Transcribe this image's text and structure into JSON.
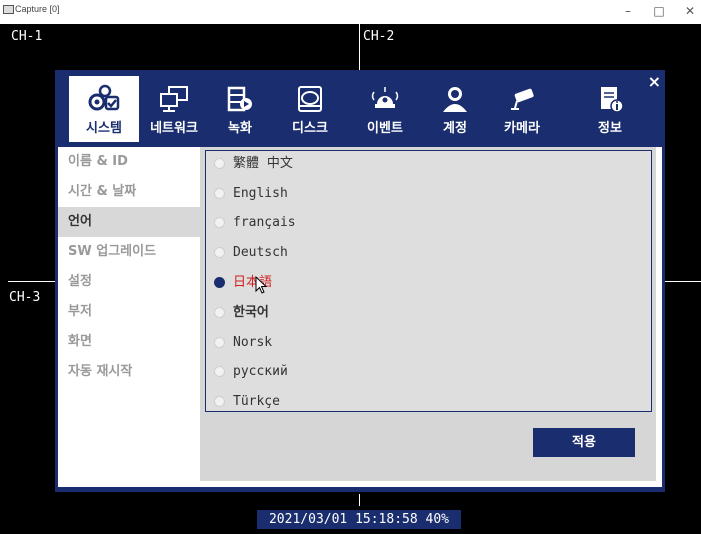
{
  "window": {
    "title": "Capture [0]",
    "minimize": "–",
    "maximize": "□",
    "close": "✕"
  },
  "channels": {
    "ch1": "CH-1",
    "ch2": "CH-2",
    "ch3": "CH-3"
  },
  "status_bar": {
    "datetime": "2021/03/01 15:18:58",
    "percent": "40%"
  },
  "dialog": {
    "close": "×",
    "tabs": [
      {
        "label": "시스템",
        "icon": "gears-icon",
        "active": true
      },
      {
        "label": "네트워크",
        "icon": "network-icon"
      },
      {
        "label": "녹화",
        "icon": "record-icon"
      },
      {
        "label": "디스크",
        "icon": "disk-icon"
      },
      {
        "label": "이벤트",
        "icon": "alarm-icon"
      },
      {
        "label": "계정",
        "icon": "user-icon"
      },
      {
        "label": "카메라",
        "icon": "camera-icon"
      },
      {
        "label": "정보",
        "icon": "info-icon"
      }
    ],
    "menu": [
      {
        "label": "이름 & ID"
      },
      {
        "label": "시간 & 날짜"
      },
      {
        "label": "언어",
        "active": true
      },
      {
        "label": "SW 업그레이드"
      },
      {
        "label": "설정"
      },
      {
        "label": "부저"
      },
      {
        "label": "화면"
      },
      {
        "label": "자동 재시작"
      }
    ],
    "languages": [
      {
        "label": "繁體 中文"
      },
      {
        "label": "English"
      },
      {
        "label": "français"
      },
      {
        "label": "Deutsch"
      },
      {
        "label": "日本語",
        "selected": true
      },
      {
        "label": "한국어"
      },
      {
        "label": "Norsk"
      },
      {
        "label": "русский"
      },
      {
        "label": "Türkçe"
      }
    ],
    "apply_button": "적용"
  },
  "colors": {
    "accent": "#1a2d6e",
    "selected_text": "#d02020",
    "panel": "#d6d6d6"
  }
}
